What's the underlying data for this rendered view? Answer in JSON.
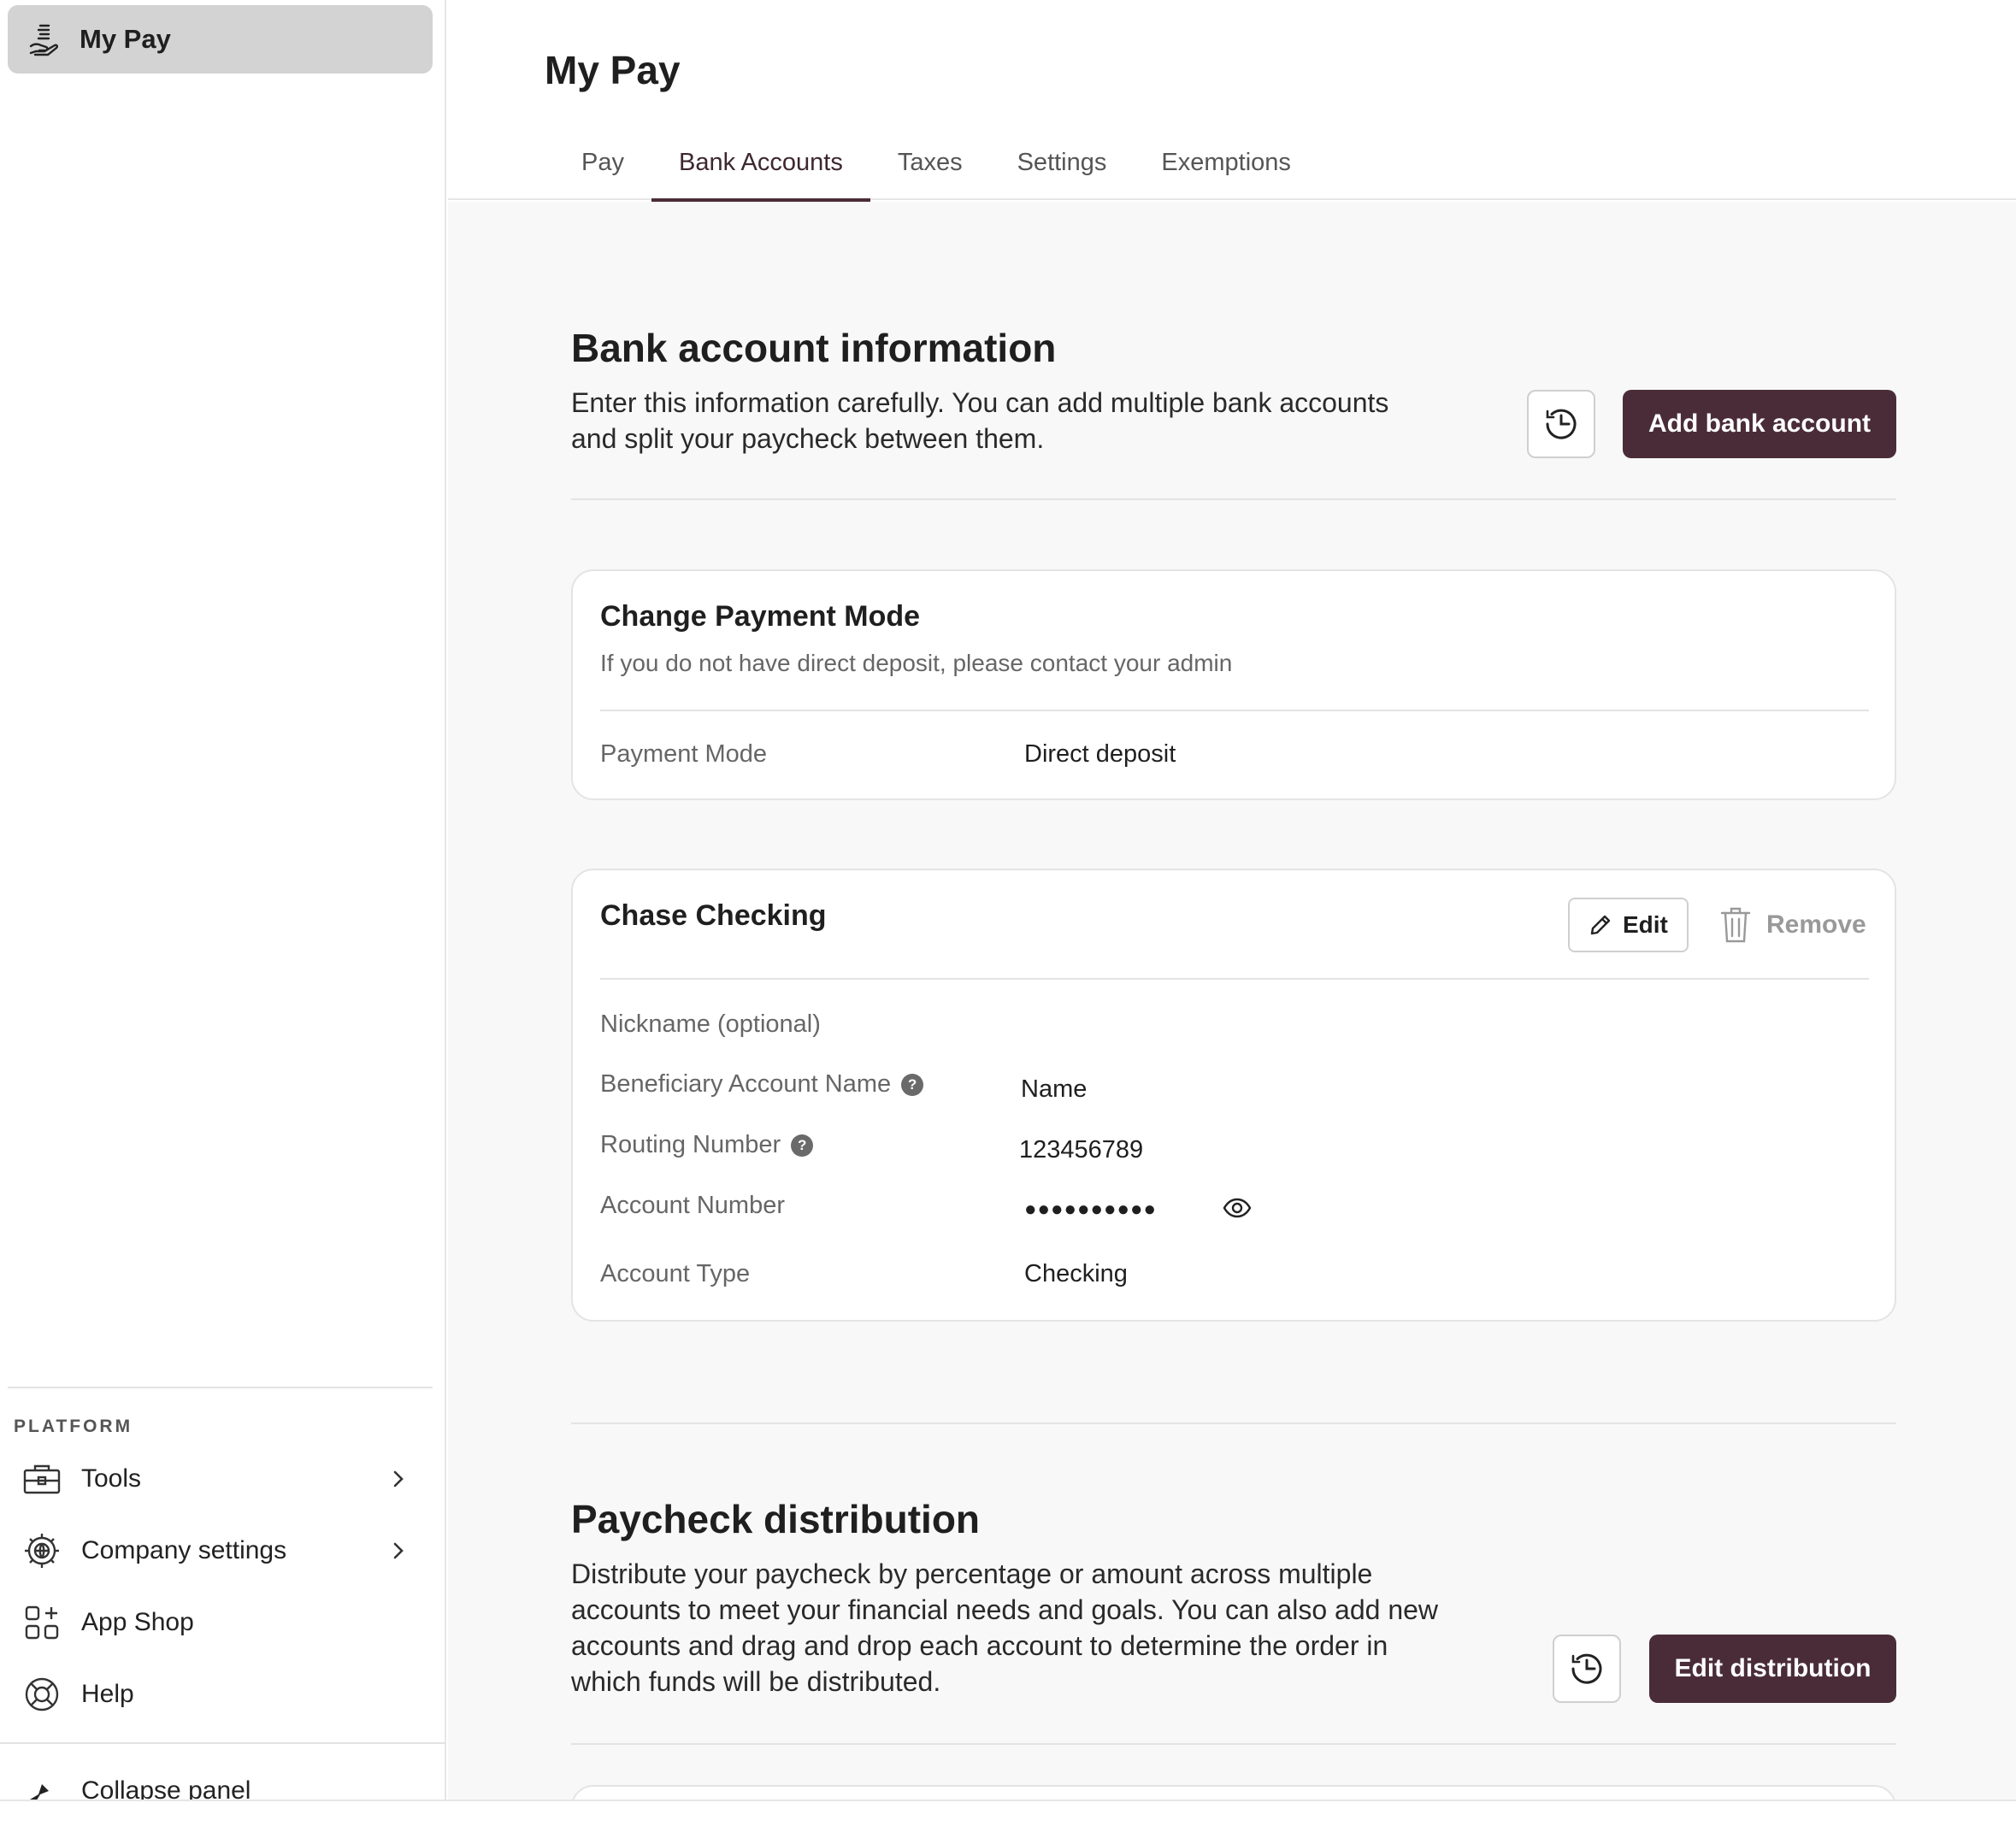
{
  "sidebar": {
    "active_item": {
      "label": "My Pay",
      "icon": "hand-coins-icon"
    },
    "section_label": "PLATFORM",
    "items": [
      {
        "label": "Tools",
        "icon": "toolbox-icon",
        "has_chevron": true
      },
      {
        "label": "Company settings",
        "icon": "gear-globe-icon",
        "has_chevron": true
      },
      {
        "label": "App Shop",
        "icon": "app-grid-plus-icon",
        "has_chevron": false
      },
      {
        "label": "Help",
        "icon": "lifebuoy-icon",
        "has_chevron": false
      }
    ],
    "collapse_label": "Collapse panel"
  },
  "header": {
    "title": "My Pay",
    "tabs": [
      {
        "label": "Pay",
        "active": false
      },
      {
        "label": "Bank Accounts",
        "active": true
      },
      {
        "label": "Taxes",
        "active": false
      },
      {
        "label": "Settings",
        "active": false
      },
      {
        "label": "Exemptions",
        "active": false
      }
    ]
  },
  "bank_info": {
    "title": "Bank account information",
    "description": "Enter this information carefully. You can add multiple bank accounts and split your paycheck between them.",
    "add_button": "Add bank account"
  },
  "payment_mode_card": {
    "title": "Change Payment Mode",
    "subtitle": "If you do not have direct deposit, please contact your admin",
    "label": "Payment Mode",
    "value": "Direct deposit"
  },
  "account_card": {
    "title": "Chase Checking",
    "edit_label": "Edit",
    "remove_label": "Remove",
    "rows": [
      {
        "label": "Nickname (optional)",
        "value": "",
        "help": false
      },
      {
        "label": "Beneficiary Account Name",
        "value": "Name",
        "help": true
      },
      {
        "label": "Routing Number",
        "value": "123456789",
        "help": true
      },
      {
        "label": "Account Number",
        "value": "●●●●●●●●●●",
        "help": false
      },
      {
        "label": "Account Type",
        "value": "Checking",
        "help": false
      }
    ]
  },
  "distribution": {
    "title": "Paycheck distribution",
    "description": "Distribute your paycheck by percentage or amount across multiple accounts to meet your financial needs and goals. You can also add new accounts and drag and drop each account to determine the order in which funds will be distributed.",
    "edit_button": "Edit distribution"
  },
  "colors": {
    "primary": "#4a2c38",
    "sidebar_active_bg": "#d3d3d3",
    "content_bg": "#f8f8f8"
  }
}
